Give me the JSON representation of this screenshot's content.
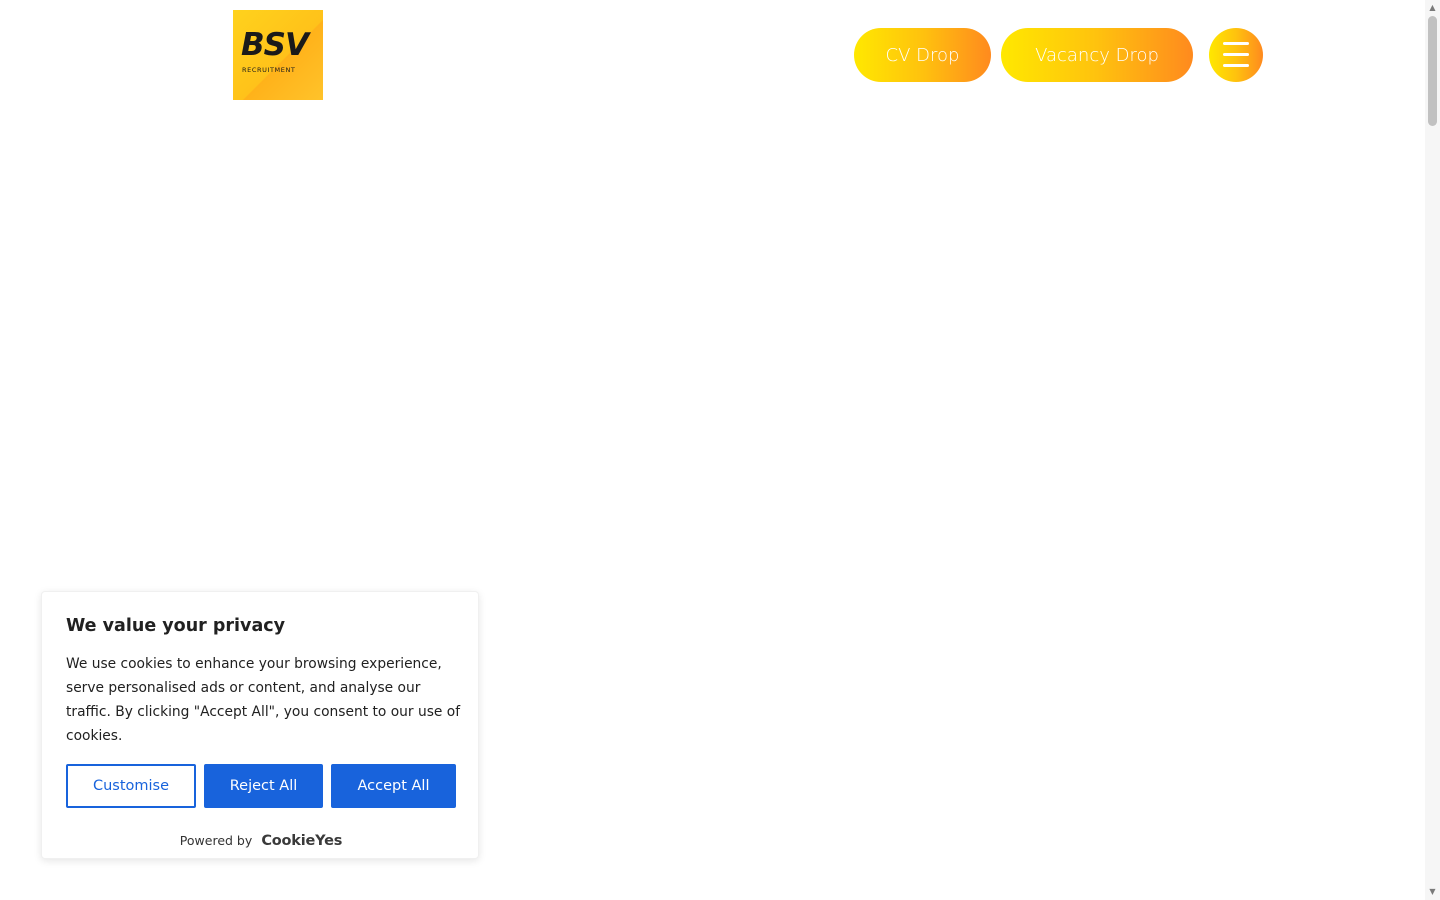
{
  "header": {
    "logo": {
      "text": "BSV",
      "subtext": "RECRUITMENT",
      "colors": {
        "primary": "#ffc21a",
        "text": "#1a1a1a"
      }
    },
    "buttons": {
      "cv_drop": "CV Drop",
      "vacancy_drop": "Vacancy Drop"
    },
    "menu_icon": "hamburger-menu-icon",
    "accent_gradient": [
      "#ffe800",
      "#ffc20e",
      "#ff8a1e"
    ]
  },
  "cookie_banner": {
    "title": "We value your privacy",
    "body": "We use cookies to enhance your browsing experience, serve personalised ads or content, and analyse our traffic. By clicking \"Accept All\", you consent to our use of cookies.",
    "buttons": {
      "customise": "Customise",
      "reject_all": "Reject All",
      "accept_all": "Accept All"
    },
    "powered_by": "Powered by",
    "powered_brand": "CookieYes",
    "accent_color": "#1863dc"
  },
  "scrollbar": {
    "up_icon": "scroll-up-arrow-icon",
    "down_icon": "scroll-down-arrow-icon"
  }
}
